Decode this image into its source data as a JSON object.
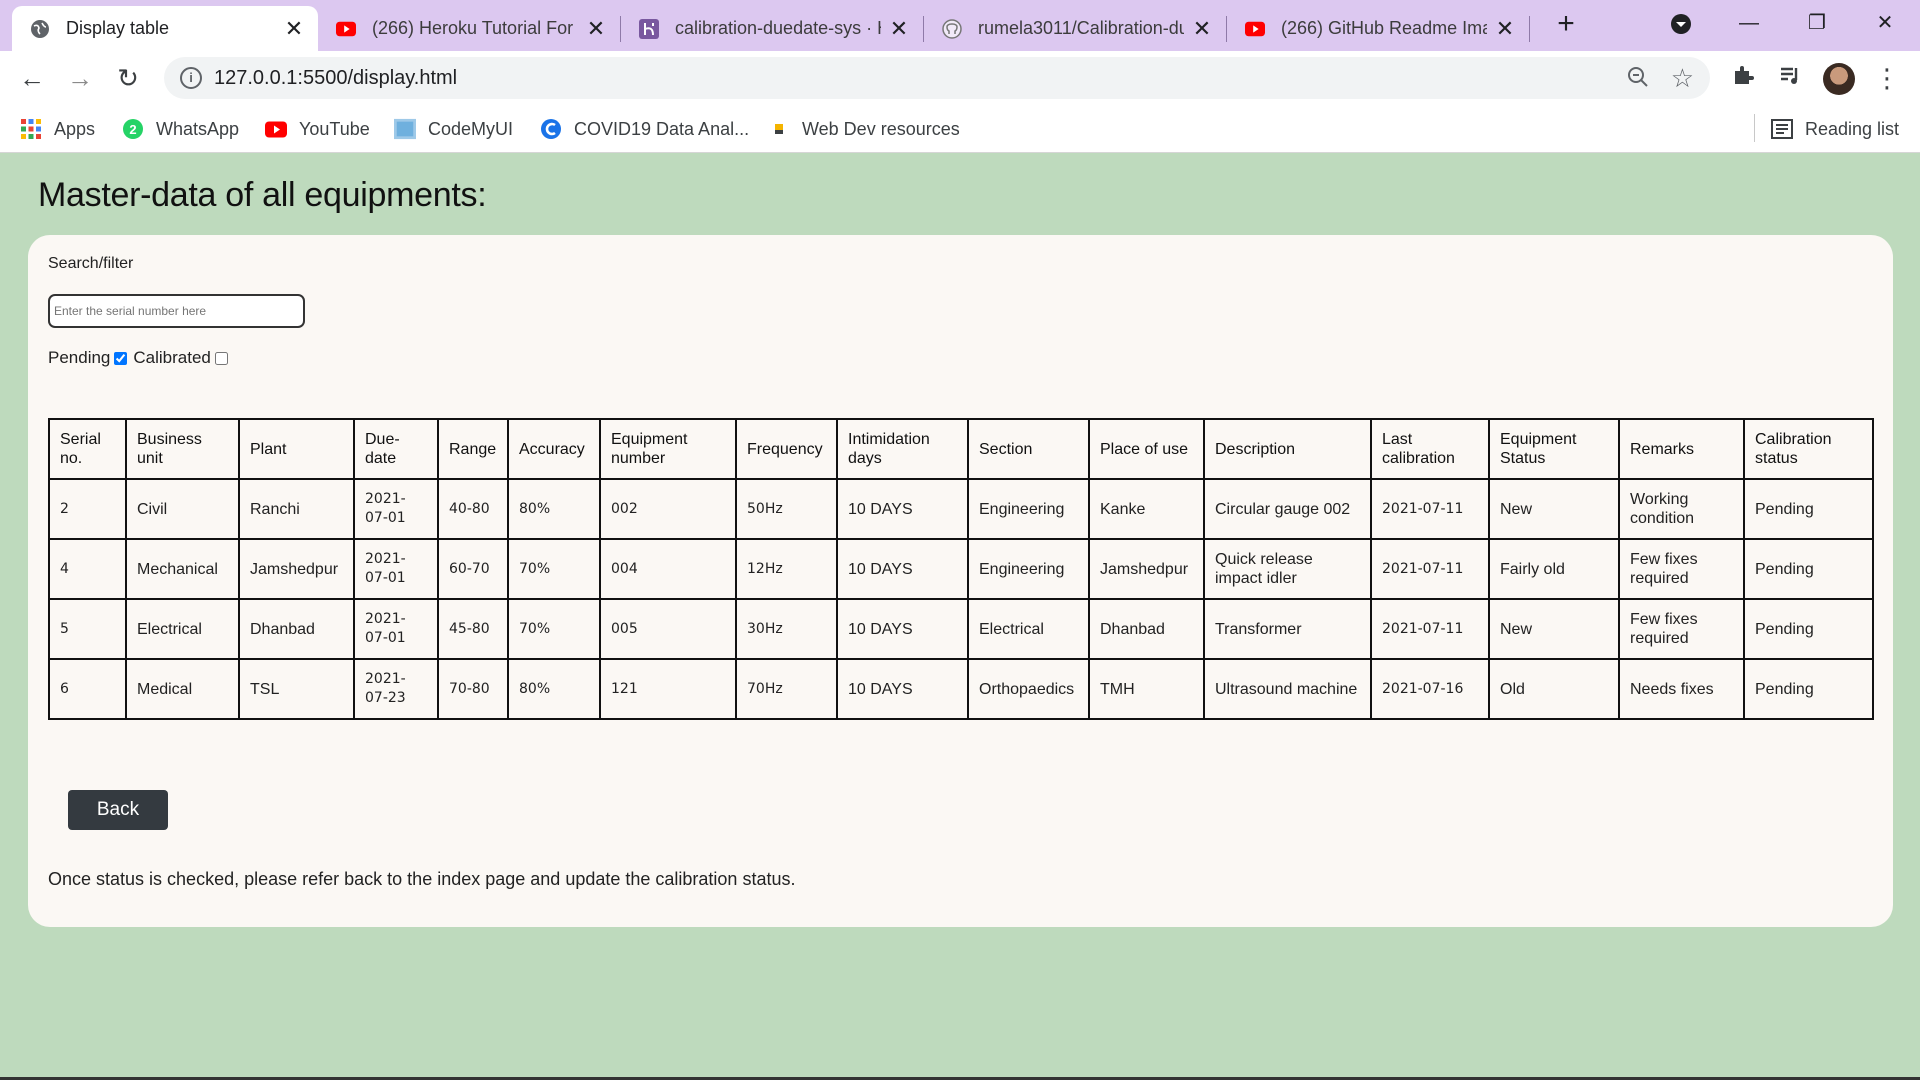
{
  "browser": {
    "tabs": [
      {
        "title": "Display table",
        "icon": "globe-icon",
        "active": true
      },
      {
        "title": "(266) Heroku Tutorial For Beginners",
        "icon": "youtube-icon"
      },
      {
        "title": "calibration-duedate-sys · Heroku",
        "icon": "heroku-icon"
      },
      {
        "title": "rumela3011/Calibration-duedate",
        "icon": "github-icon"
      },
      {
        "title": "(266) GitHub Readme Images",
        "icon": "youtube-icon"
      }
    ],
    "url": "127.0.0.1:5500/display.html",
    "bookmarks": [
      {
        "label": "Apps",
        "icon": "apps-grid-icon"
      },
      {
        "label": "WhatsApp",
        "icon": "whatsapp-icon"
      },
      {
        "label": "YouTube",
        "icon": "youtube-icon"
      },
      {
        "label": "CodeMyUI",
        "icon": "codemyui-icon"
      },
      {
        "label": "COVID19 Data Anal...",
        "icon": "chrome-c-icon"
      },
      {
        "label": "Web Dev resources",
        "icon": "folder-icon"
      }
    ],
    "reading_list": "Reading list"
  },
  "page": {
    "title": "Master-data of all equipments:",
    "search_label": "Search/filter",
    "search_placeholder": "Enter the serial number here",
    "filter_pending": "Pending",
    "filter_calibrated": "Calibrated",
    "back_label": "Back",
    "note": "Once status is checked, please refer back to the index page and update the calibration status."
  },
  "table": {
    "headers": [
      "Serial no.",
      "Business unit",
      "Plant",
      "Due-date",
      "Range",
      "Accuracy",
      "Equipment number",
      "Frequency",
      "Intimidation days",
      "Section",
      "Place of use",
      "Description",
      "Last calibration",
      "Equipment Status",
      "Remarks",
      "Calibration status"
    ],
    "rows": [
      [
        "2",
        "Civil",
        "Ranchi",
        "2021-07-01",
        "40-80",
        "80%",
        "002",
        "50Hz",
        "10 DAYS",
        "Engineering",
        "Kanke",
        "Circular gauge 002",
        "2021-07-11",
        "New",
        "Working condition",
        "Pending"
      ],
      [
        "4",
        "Mechanical",
        "Jamshedpur",
        "2021-07-01",
        "60-70",
        "70%",
        "004",
        "12Hz",
        "10 DAYS",
        "Engineering",
        "Jamshedpur",
        "Quick release impact idler",
        "2021-07-11",
        "Fairly old",
        "Few fixes required",
        "Pending"
      ],
      [
        "5",
        "Electrical",
        "Dhanbad",
        "2021-07-01",
        "45-80",
        "70%",
        "005",
        "30Hz",
        "10 DAYS",
        "Electrical",
        "Dhanbad",
        "Transformer",
        "2021-07-11",
        "New",
        "Few fixes required",
        "Pending"
      ],
      [
        "6",
        "Medical",
        "TSL",
        "2021-07-23",
        "70-80",
        "80%",
        "121",
        "70Hz",
        "10 DAYS",
        "Orthopaedics",
        "TMH",
        "Ultrasound machine",
        "2021-07-16",
        "Old",
        "Needs fixes",
        "Pending"
      ]
    ]
  }
}
